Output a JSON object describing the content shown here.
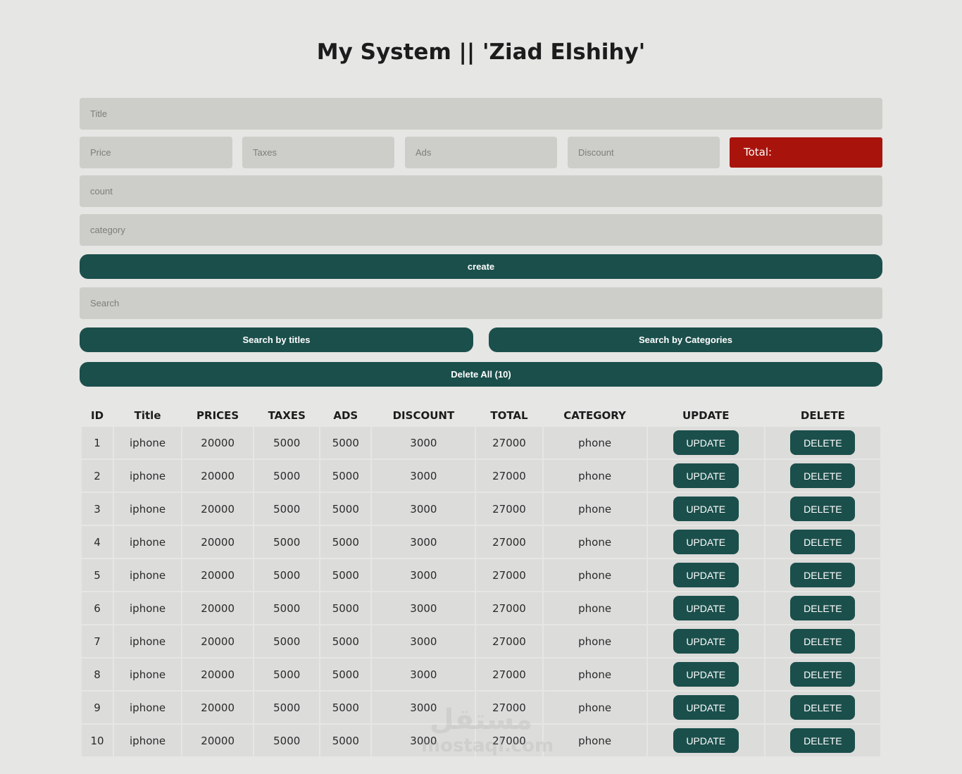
{
  "header": {
    "title": "My System || 'Ziad Elshihy'"
  },
  "form": {
    "title_placeholder": "Title",
    "price_placeholder": "Price",
    "taxes_placeholder": "Taxes",
    "ads_placeholder": "Ads",
    "discount_placeholder": "Discount",
    "total_label": "Total:",
    "count_placeholder": "count",
    "category_placeholder": "category",
    "create_label": "create"
  },
  "search": {
    "placeholder": "Search",
    "by_titles_label": "Search by titles",
    "by_categories_label": "Search by Categories"
  },
  "delete_all_label": "Delete All (10)",
  "table": {
    "headers": [
      "ID",
      "Title",
      "PRICES",
      "TAXES",
      "ADS",
      "DISCOUNT",
      "TOTAL",
      "CATEGORY",
      "UPDATE",
      "DELETE"
    ],
    "update_label": "UPDATE",
    "delete_label": "DELETE",
    "rows": [
      {
        "id": "1",
        "title": "iphone",
        "price": "20000",
        "taxes": "5000",
        "ads": "5000",
        "discount": "3000",
        "total": "27000",
        "category": "phone"
      },
      {
        "id": "2",
        "title": "iphone",
        "price": "20000",
        "taxes": "5000",
        "ads": "5000",
        "discount": "3000",
        "total": "27000",
        "category": "phone"
      },
      {
        "id": "3",
        "title": "iphone",
        "price": "20000",
        "taxes": "5000",
        "ads": "5000",
        "discount": "3000",
        "total": "27000",
        "category": "phone"
      },
      {
        "id": "4",
        "title": "iphone",
        "price": "20000",
        "taxes": "5000",
        "ads": "5000",
        "discount": "3000",
        "total": "27000",
        "category": "phone"
      },
      {
        "id": "5",
        "title": "iphone",
        "price": "20000",
        "taxes": "5000",
        "ads": "5000",
        "discount": "3000",
        "total": "27000",
        "category": "phone"
      },
      {
        "id": "6",
        "title": "iphone",
        "price": "20000",
        "taxes": "5000",
        "ads": "5000",
        "discount": "3000",
        "total": "27000",
        "category": "phone"
      },
      {
        "id": "7",
        "title": "iphone",
        "price": "20000",
        "taxes": "5000",
        "ads": "5000",
        "discount": "3000",
        "total": "27000",
        "category": "phone"
      },
      {
        "id": "8",
        "title": "iphone",
        "price": "20000",
        "taxes": "5000",
        "ads": "5000",
        "discount": "3000",
        "total": "27000",
        "category": "phone"
      },
      {
        "id": "9",
        "title": "iphone",
        "price": "20000",
        "taxes": "5000",
        "ads": "5000",
        "discount": "3000",
        "total": "27000",
        "category": "phone"
      },
      {
        "id": "10",
        "title": "iphone",
        "price": "20000",
        "taxes": "5000",
        "ads": "5000",
        "discount": "3000",
        "total": "27000",
        "category": "phone"
      }
    ]
  },
  "watermark": {
    "arabic": "مستقل",
    "latin": "mostaql.com"
  },
  "colors": {
    "accent": "#1b4f4b",
    "total_bg": "#a8140c",
    "field_bg": "#cdcdc9",
    "page_bg": "#e6e6e4"
  }
}
